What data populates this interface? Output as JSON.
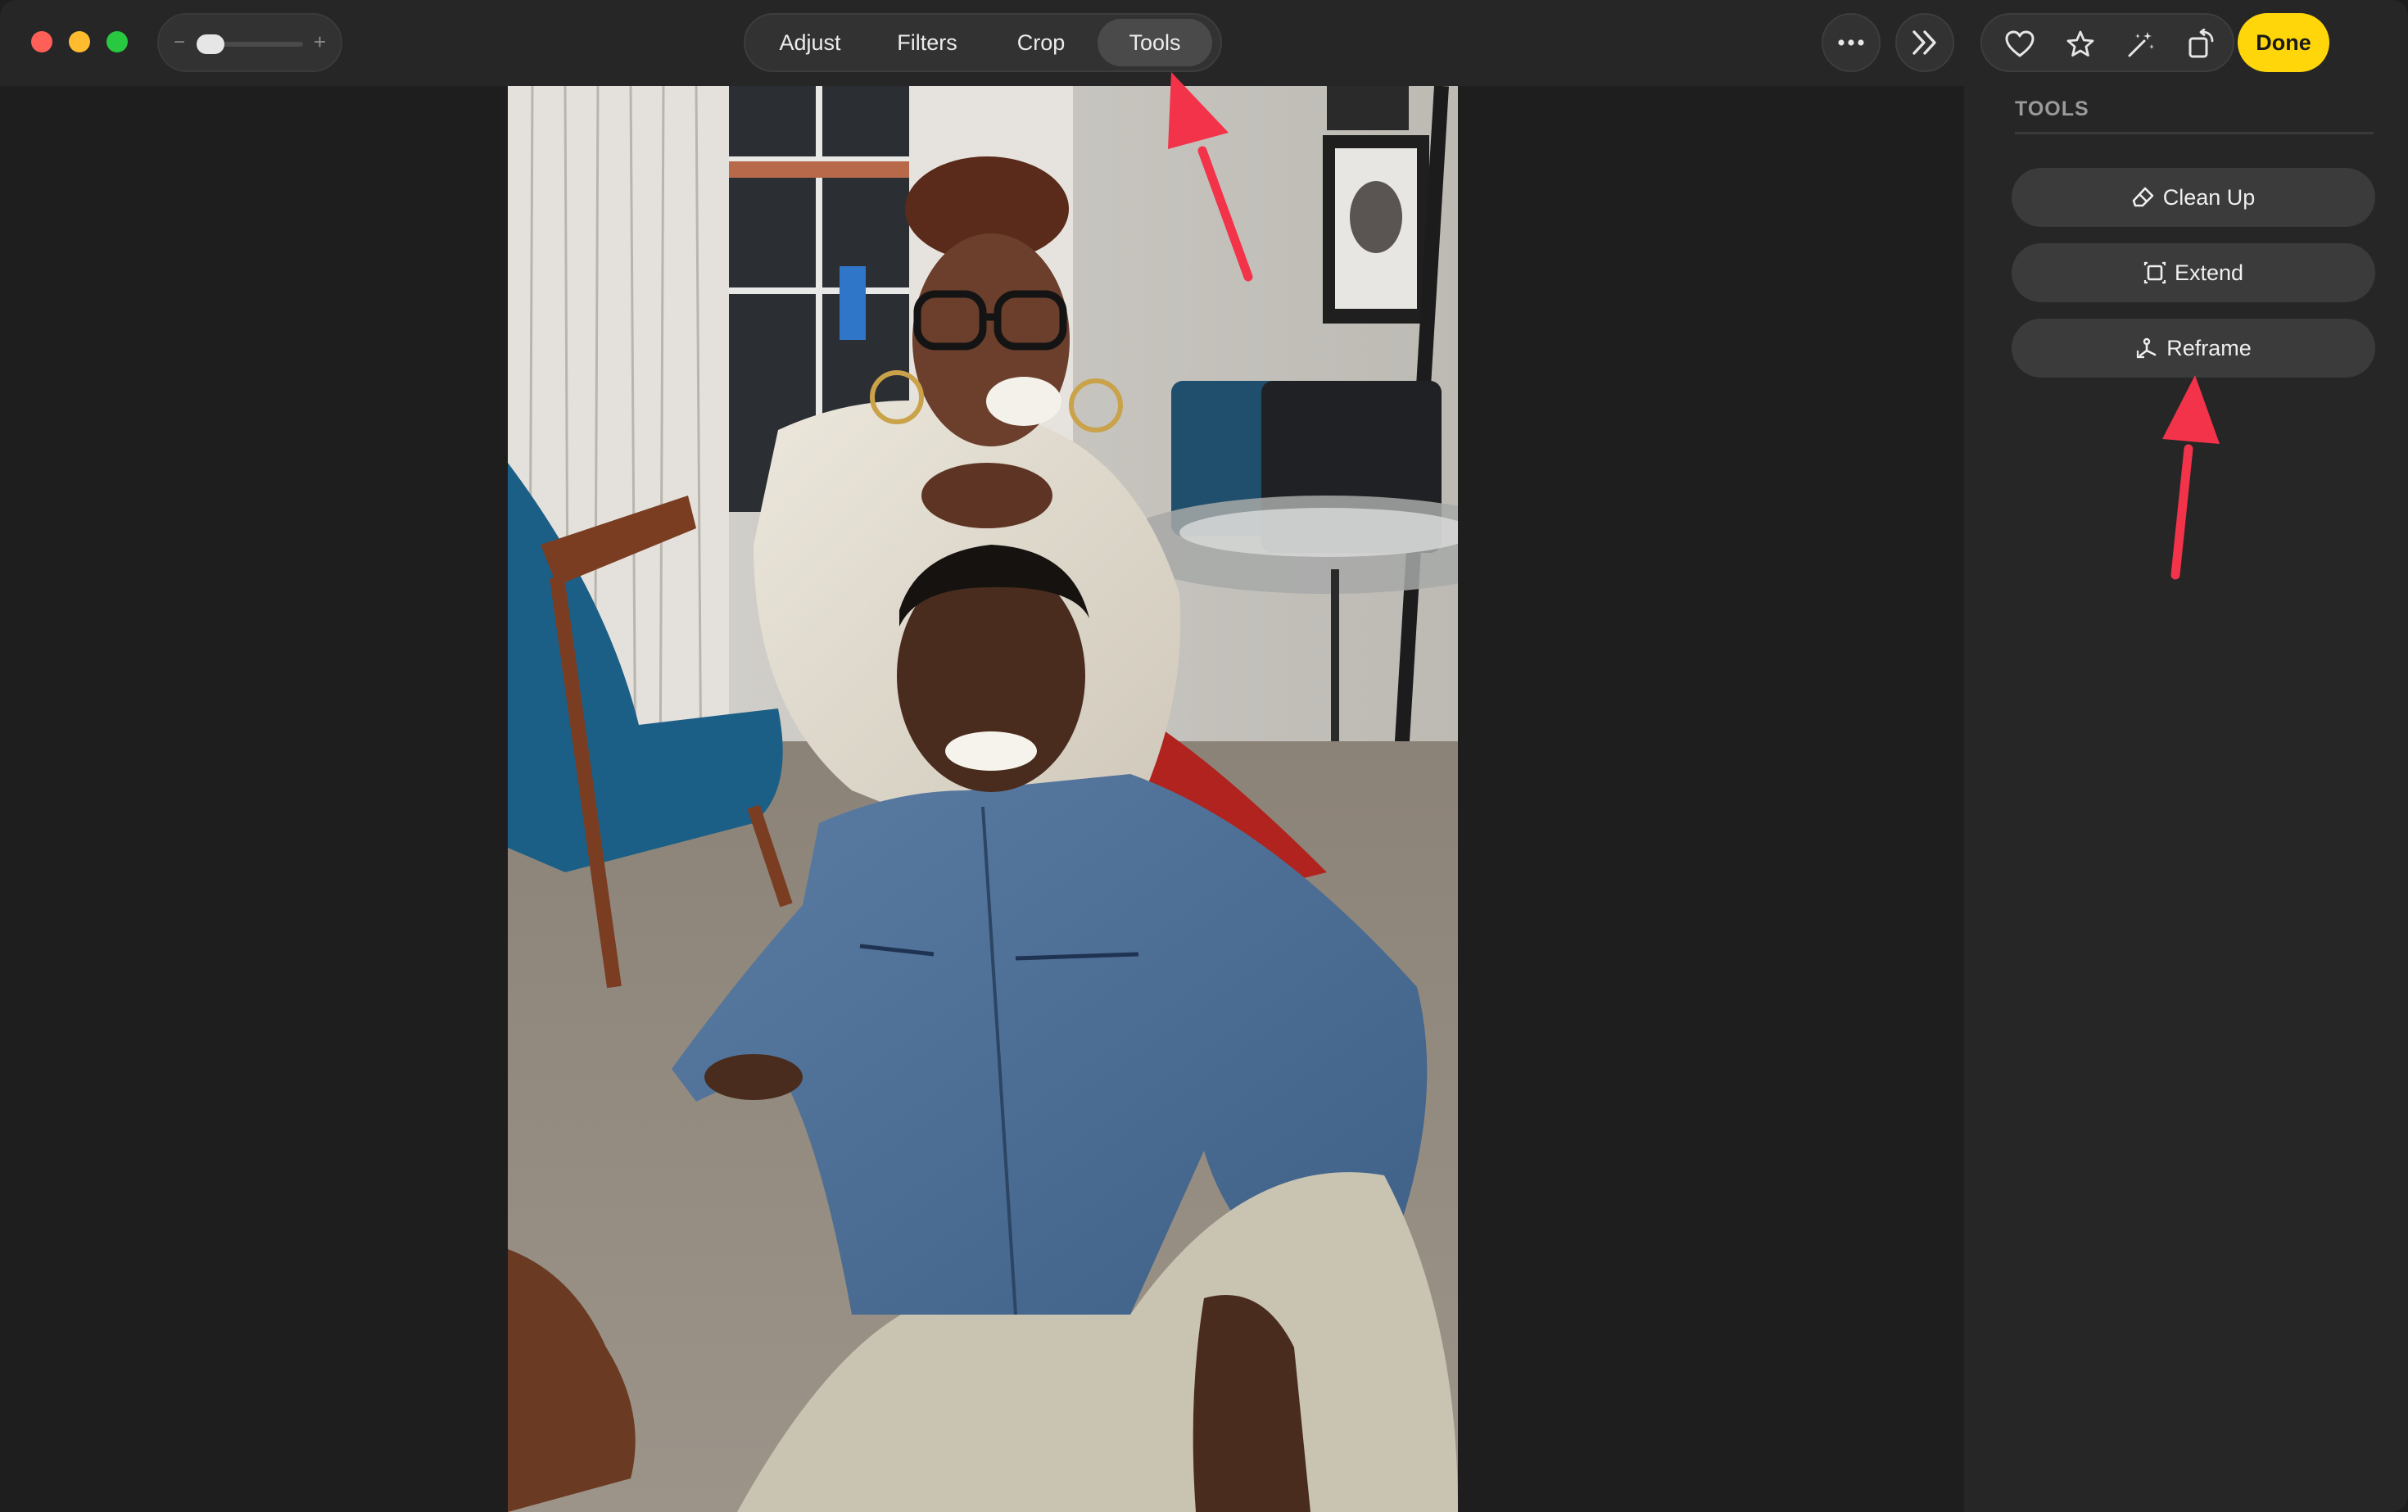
{
  "toolbar": {
    "zoom": {
      "minus": "−",
      "plus": "+"
    },
    "tabs": [
      {
        "label": "Adjust",
        "selected": false
      },
      {
        "label": "Filters",
        "selected": false
      },
      {
        "label": "Crop",
        "selected": false
      },
      {
        "label": "Tools",
        "selected": true
      }
    ],
    "more_icon": "ellipsis-icon",
    "forward_icon": "double-chevron-right-icon",
    "actions": [
      "heart-icon",
      "star-icon",
      "magic-wand-icon",
      "rotate-icon"
    ],
    "done_label": "Done"
  },
  "sidebar": {
    "title": "TOOLS",
    "tools": [
      {
        "label": "Clean Up",
        "icon": "eraser-icon"
      },
      {
        "label": "Extend",
        "icon": "extend-icon"
      },
      {
        "label": "Reframe",
        "icon": "reframe-icon"
      }
    ]
  },
  "colors": {
    "done": "#ffd60a",
    "annotation_arrow": "#f2334a",
    "traffic_red": "#fe5f57",
    "traffic_yellow": "#febc2e",
    "traffic_green": "#28c840"
  }
}
